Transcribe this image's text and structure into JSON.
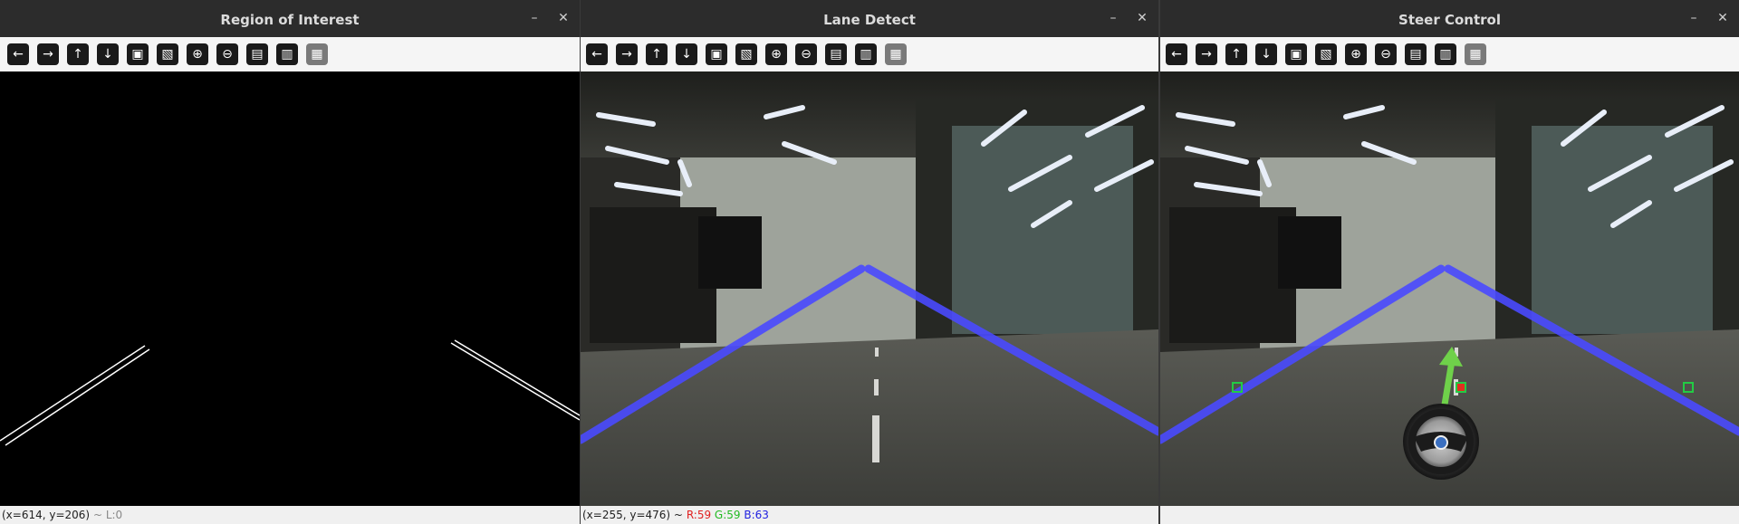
{
  "windows": [
    {
      "title": "Region of Interest",
      "status": {
        "coords": "(x=614, y=206)",
        "extra": "~ L:0"
      }
    },
    {
      "title": "Lane Detect",
      "status": {
        "coords": "(x=255, y=476) ~",
        "r": "R:59",
        "g": "G:59",
        "b": "B:63"
      }
    },
    {
      "title": "Steer Control",
      "status": {
        "coords": ""
      }
    }
  ],
  "titlebar_buttons": {
    "minimize": "–",
    "close": "✕"
  },
  "toolbar_icons": [
    "arrow-left-icon",
    "arrow-right-icon",
    "arrow-up-icon",
    "arrow-down-icon",
    "image-icon",
    "image-edit-icon",
    "zoom-in-icon",
    "zoom-out-icon",
    "save-icon",
    "clipboard-icon",
    "properties-icon"
  ],
  "toolbar_glyphs": [
    "←",
    "→",
    "↑",
    "↓",
    "▣",
    "▧",
    "⊕",
    "⊖",
    "▤",
    "▥",
    "▦"
  ],
  "colors": {
    "lane": "#4a4aff",
    "arrow": "#6fd14a",
    "marker": "#22cc44",
    "center_marker": "#e03020",
    "r": "#e02020",
    "g": "#22bb22",
    "b": "#2020e0"
  }
}
